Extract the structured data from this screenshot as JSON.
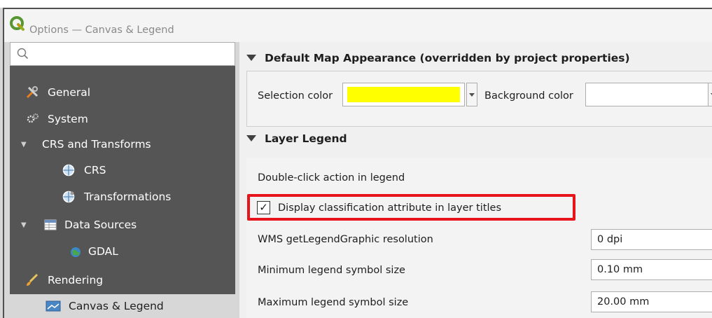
{
  "window": {
    "title": "Options — Canvas & Legend"
  },
  "sidebar": {
    "search_placeholder": "",
    "items": [
      {
        "label": "General",
        "icon": "tools-icon"
      },
      {
        "label": "System",
        "icon": "gears-icon"
      },
      {
        "label": "CRS and Transforms",
        "icon": "collapse-arrow"
      },
      {
        "label": "CRS",
        "icon": "globe-icon"
      },
      {
        "label": "Transformations",
        "icon": "globe-transform-icon"
      },
      {
        "label": "Data Sources",
        "icon": "table-icon"
      },
      {
        "label": "GDAL",
        "icon": "globe-gdal-icon"
      },
      {
        "label": "Rendering",
        "icon": "brush-icon"
      },
      {
        "label": "Canvas & Legend",
        "icon": "canvas-icon"
      }
    ],
    "selected": "Canvas & Legend"
  },
  "main": {
    "section1": {
      "title": "Default Map Appearance (overridden by project properties)",
      "selection_color_label": "Selection color",
      "selection_color": "#ffff00",
      "background_color_label": "Background color",
      "background_color": "#ffffff"
    },
    "section2": {
      "title": "Layer Legend",
      "double_click_label": "Double-click action in legend",
      "checkbox_label": "Display classification attribute in layer titles",
      "checkbox_checked": true,
      "checkbox_mark": "✓",
      "wms_label": "WMS getLegendGraphic resolution",
      "wms_value": "0 dpi",
      "min_symbol_label": "Minimum legend symbol size",
      "min_symbol_value": "0.10 mm",
      "max_symbol_label": "Maximum legend symbol size",
      "max_symbol_value": "20.00 mm"
    }
  },
  "colors": {
    "sidebar_bg": "#555555",
    "highlight_border": "#e8141c",
    "selection_yellow": "#ffff00"
  }
}
